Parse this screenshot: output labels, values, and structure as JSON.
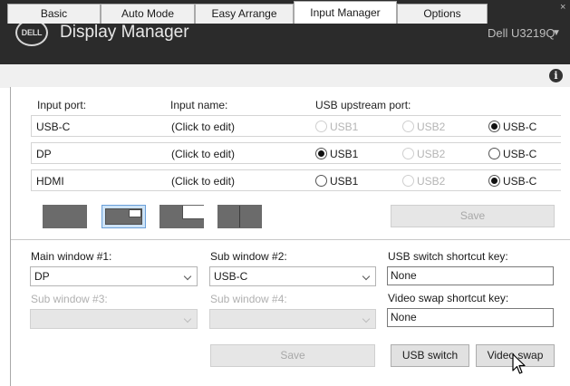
{
  "app": {
    "logo_text": "DELL",
    "title": "Display Manager",
    "monitor": "Dell U3219Q",
    "monitor_caret": "▼",
    "close_glyph": "×"
  },
  "tabs": [
    {
      "label": "Basic"
    },
    {
      "label": "Auto Mode"
    },
    {
      "label": "Easy Arrange"
    },
    {
      "label": "Input Manager",
      "active": true
    },
    {
      "label": "Options"
    }
  ],
  "info_glyph": "i",
  "table": {
    "headers": {
      "port": "Input port:",
      "name": "Input name:",
      "usb": "USB upstream port:"
    },
    "usb_options": [
      "USB1",
      "USB2",
      "USB-C"
    ],
    "rows": [
      {
        "port": "USB-C",
        "name": "(Click to edit)",
        "selected": "USB-C",
        "disabled": [
          "USB1",
          "USB2"
        ]
      },
      {
        "port": "DP",
        "name": "(Click to edit)",
        "selected": "USB1",
        "disabled": [
          "USB2"
        ]
      },
      {
        "port": "HDMI",
        "name": "(Click to edit)",
        "selected": "USB-C",
        "disabled": [
          "USB2"
        ]
      }
    ]
  },
  "layouts": {
    "icons": [
      "single-window",
      "picture-in-picture",
      "picture-by-picture-small",
      "side-by-side"
    ],
    "selected_index": 1
  },
  "top_save_label": "Save",
  "windows": {
    "main1": {
      "label": "Main window #1:",
      "value": "DP"
    },
    "sub2": {
      "label": "Sub window #2:",
      "value": "USB-C"
    },
    "sub3": {
      "label": "Sub window #3:",
      "value": ""
    },
    "sub4": {
      "label": "Sub window #4:",
      "value": ""
    }
  },
  "shortcuts": {
    "usb_label": "USB switch shortcut key:",
    "usb_value": "None",
    "video_label": "Video swap shortcut key:",
    "video_value": "None"
  },
  "buttons": {
    "save": "Save",
    "usb_switch": "USB switch",
    "video_swap": "Video swap"
  }
}
